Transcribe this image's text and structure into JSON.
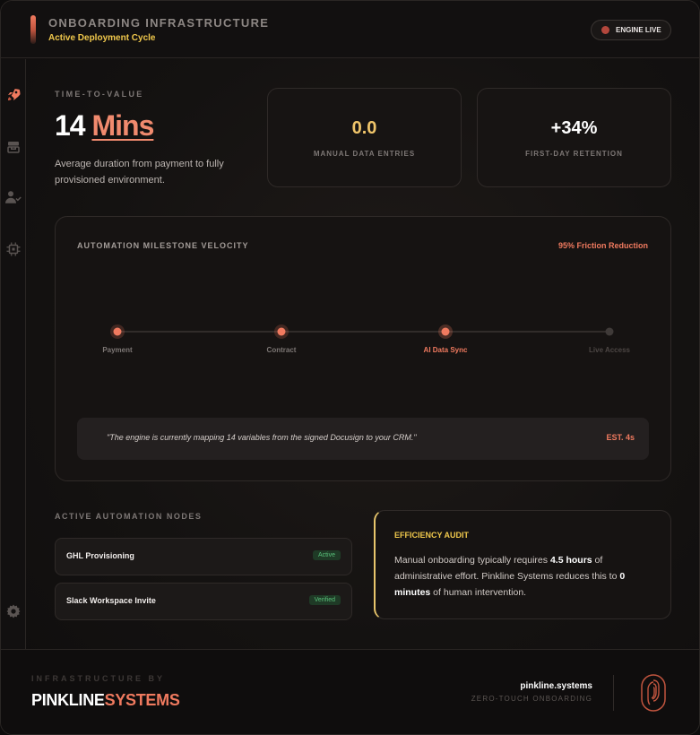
{
  "header": {
    "title": "ONBOARDING INFRASTRUCTURE",
    "subtitle": "Active Deployment Cycle",
    "status_pill": {
      "label": "ENGINE LIVE",
      "dot_color": "#b3473c"
    }
  },
  "sidebar": {
    "items": [
      {
        "icon": "rocket-icon",
        "active": true
      },
      {
        "icon": "layers-icon",
        "active": false
      },
      {
        "icon": "user-check-icon",
        "active": false
      },
      {
        "icon": "chip-icon",
        "active": false
      },
      {
        "icon": "gear-icon",
        "active": false
      }
    ]
  },
  "time_to_value": {
    "label": "TIME-TO-VALUE",
    "number": "14",
    "unit": "Mins",
    "description": "Average duration from payment to fully provisioned environment."
  },
  "stats": [
    {
      "value": "0.0",
      "label": "MANUAL DATA ENTRIES",
      "color": "#f0c56a"
    },
    {
      "value": "+34%",
      "label": "FIRST-DAY RETENTION",
      "color": "#ffffff"
    }
  ],
  "milestones": {
    "title": "AUTOMATION MILESTONE VELOCITY",
    "badge": "95% Friction Reduction",
    "steps": [
      {
        "label": "Payment",
        "state": "done"
      },
      {
        "label": "Contract",
        "state": "done"
      },
      {
        "label": "AI Data Sync",
        "state": "current"
      },
      {
        "label": "Live Access",
        "state": "pending"
      }
    ],
    "note": "\"The engine is currently mapping 14 variables from the signed Docusign to your CRM.\"",
    "estimate": "EST. 4s"
  },
  "nodes": {
    "title": "ACTIVE AUTOMATION NODES",
    "items": [
      {
        "name": "GHL Provisioning",
        "status": "Active"
      },
      {
        "name": "Slack Workspace Invite",
        "status": "Verified"
      }
    ]
  },
  "audit": {
    "title": "EFFICIENCY AUDIT",
    "text_1": "Manual onboarding typically requires ",
    "bold_1": "4.5 hours",
    "text_2": " of administrative effort. Pinkline Systems reduces this to ",
    "bold_2": "0 minutes",
    "text_3": " of human intervention."
  },
  "footer": {
    "infra_by": "INFRASTRUCTURE BY",
    "brand_part1": "PINKLINE",
    "brand_part2": "SYSTEMS",
    "domain": "pinkline.systems",
    "tagline": "ZERO-TOUCH ONBOARDING",
    "logo_icon": "fingerprint-icon"
  },
  "colors": {
    "accent": "#f07a5f",
    "gold": "#f0c84c",
    "success": "#59c07a"
  }
}
